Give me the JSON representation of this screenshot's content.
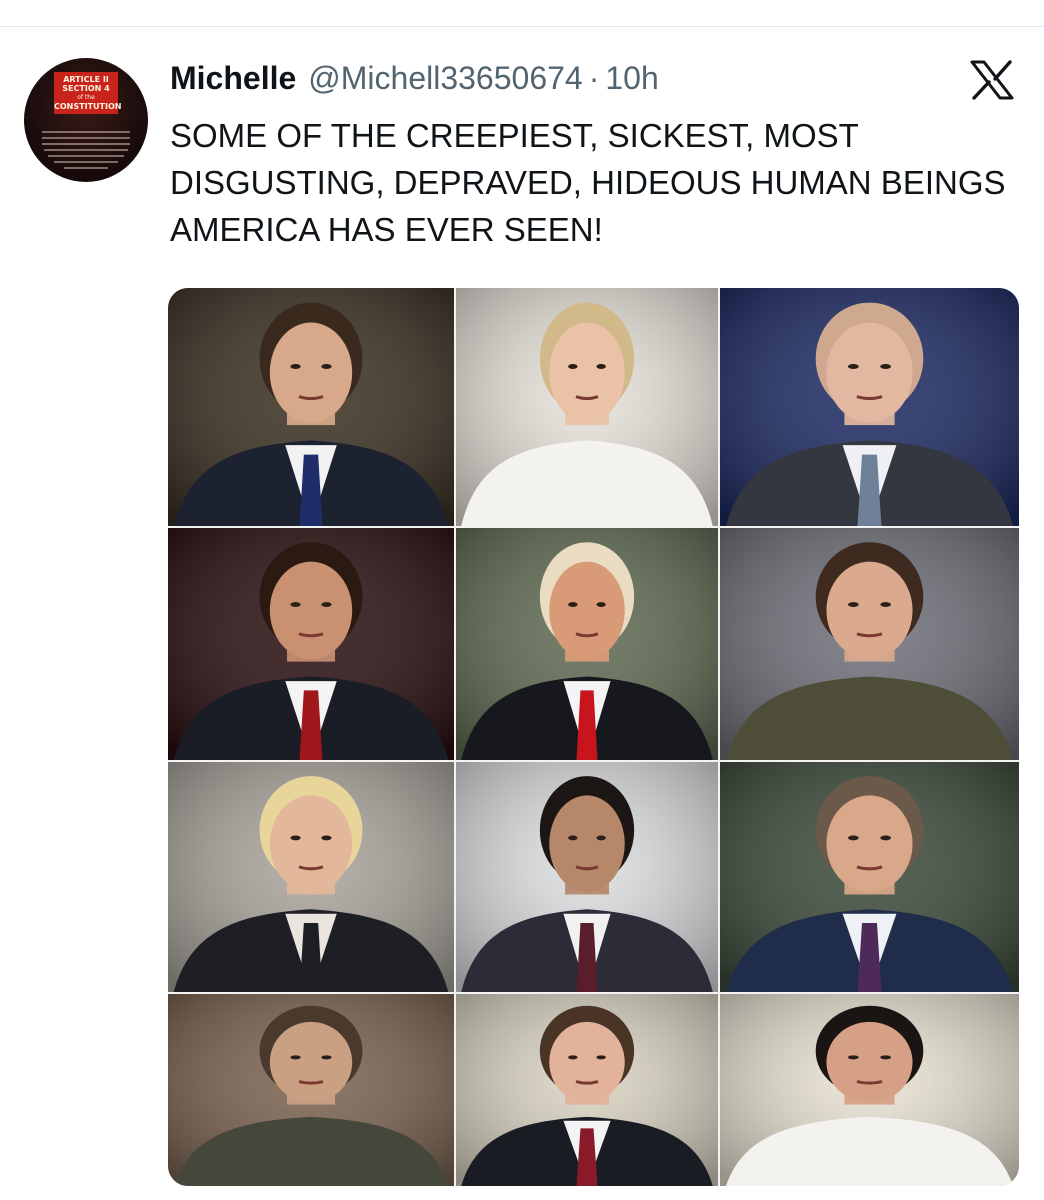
{
  "tweet": {
    "author": {
      "display_name": "Michelle",
      "handle": "@Michell33650674",
      "separator": "·",
      "time": "10h",
      "avatar_text": {
        "line1": "ARTICLE II",
        "line2": "SECTION 4",
        "line3": "of the",
        "line4": "CONSTITUTION"
      }
    },
    "platform_icon": "x-logo-icon",
    "text": "SOME OF THE CREEPIEST, SICKEST, MOST DISGUSTING, DEPRAVED, HIDEOUS HUMAN BEINGS AMERICA HAS EVER SEEN!",
    "photo_grid": {
      "rows": 4,
      "columns": 3,
      "photos": [
        {
          "id": "photo-1",
          "bg": "#3b3022",
          "skin": "#d7a98a",
          "hair": "#3a2a1e",
          "suit": "#1d2230",
          "shirt": "#f2f2f2",
          "tie": "#1f2e6b"
        },
        {
          "id": "photo-2",
          "bg": "#e7e2da",
          "skin": "#e9c2a8",
          "hair": "#d2b98a",
          "suit": "#f4f2ee",
          "shirt": "#f4f2ee",
          "tie": "#f4f2ee"
        },
        {
          "id": "photo-3",
          "bg": "#1c2a63",
          "skin": "#e2b8a0",
          "hair": "#cfa98f",
          "suit": "#34373f",
          "shirt": "#eef0f4",
          "tie": "#6e8198"
        },
        {
          "id": "photo-4",
          "bg": "#2a0e10",
          "skin": "#c99072",
          "hair": "#2a1a12",
          "suit": "#1a1c26",
          "shirt": "#f4f4f4",
          "tie": "#a0181c"
        },
        {
          "id": "photo-5",
          "bg": "#5f6a52",
          "skin": "#d99a78",
          "hair": "#e9dcc0",
          "suit": "#16181e",
          "shirt": "#f4f4f4",
          "tie": "#c8141c"
        },
        {
          "id": "photo-6",
          "bg": "#6f7079",
          "skin": "#dba98d",
          "hair": "#3e2a1e",
          "suit": "#4e4d38",
          "shirt": "#4e4d38",
          "tie": "#4e4d38"
        },
        {
          "id": "photo-7",
          "bg": "#a9a49c",
          "skin": "#e3b79a",
          "hair": "#e8d59a",
          "suit": "#1e1f24",
          "shirt": "#e9e4de",
          "tie": "#1e1f24"
        },
        {
          "id": "photo-8",
          "bg": "#dcdedf",
          "skin": "#b7876a",
          "hair": "#1c1614",
          "suit": "#2b2c38",
          "shirt": "#f1f1f1",
          "tie": "#5a1d2a"
        },
        {
          "id": "photo-9",
          "bg": "#3c4a3a",
          "skin": "#d9a88a",
          "hair": "#6b5a4a",
          "suit": "#1f2c4a",
          "shirt": "#eef1f6",
          "tie": "#4d2a5a"
        },
        {
          "id": "photo-10",
          "bg": "#7a6250",
          "skin": "#caa083",
          "hair": "#4a3a2e",
          "suit": "#45473a",
          "shirt": "#45473a",
          "tie": "#45473a"
        },
        {
          "id": "photo-11",
          "bg": "#d9d3c2",
          "skin": "#e2b39a",
          "hair": "#4a3426",
          "suit": "#1a1c24",
          "shirt": "#f3f3f3",
          "tie": "#8a1a2a"
        },
        {
          "id": "photo-12",
          "bg": "#e8e2d2",
          "skin": "#d5a086",
          "hair": "#1a1412",
          "suit": "#f4f2ee",
          "shirt": "#f4f2ee",
          "tie": "#f4f2ee"
        }
      ]
    }
  }
}
